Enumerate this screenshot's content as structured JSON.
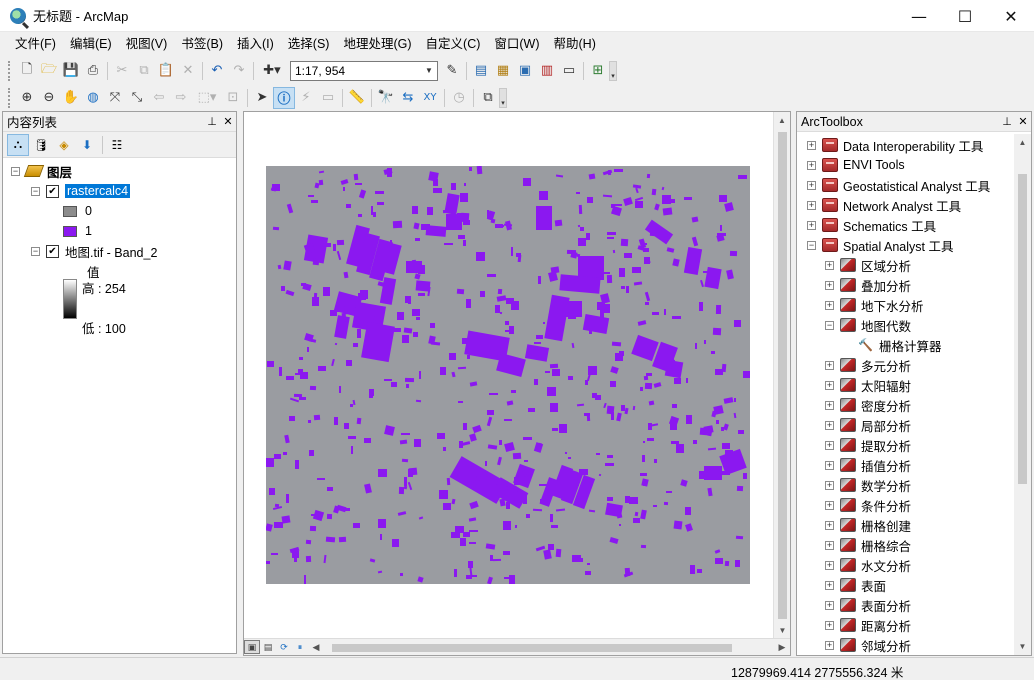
{
  "window": {
    "title": "无标题 - ArcMap",
    "controls": {
      "minimize": "—",
      "maximize": "☐",
      "close": "✕"
    }
  },
  "menu": [
    "文件(F)",
    "编辑(E)",
    "视图(V)",
    "书签(B)",
    "插入(I)",
    "选择(S)",
    "地理处理(G)",
    "自定义(C)",
    "窗口(W)",
    "帮助(H)"
  ],
  "toolbar": {
    "scale": "1:17, 954"
  },
  "toc": {
    "title": "内容列表",
    "pin": "⊥",
    "close": "✕",
    "root_label": "图层",
    "layers": [
      {
        "name": "rastercalc4",
        "checked": true,
        "selected": true,
        "classes": [
          {
            "label": "0",
            "color": "#8c8c8c"
          },
          {
            "label": "1",
            "color": "#8b18f0"
          }
        ]
      },
      {
        "name": "地图.tif - Band_2",
        "checked": true,
        "legend_title": "值",
        "high_label": "高 : 254",
        "low_label": "低 : 100"
      }
    ]
  },
  "map": {
    "background": "#9a9ca1",
    "feature_color": "#8b18f0"
  },
  "toolbox": {
    "title": "ArcToolbox",
    "pin": "⊥",
    "close": "✕",
    "items": [
      {
        "label": "Data Interoperability 工具",
        "level": 0,
        "expander": "+",
        "icon": "box"
      },
      {
        "label": "ENVI Tools",
        "level": 0,
        "expander": "+",
        "icon": "box"
      },
      {
        "label": "Geostatistical Analyst 工具",
        "level": 0,
        "expander": "+",
        "icon": "box"
      },
      {
        "label": "Network Analyst 工具",
        "level": 0,
        "expander": "+",
        "icon": "box"
      },
      {
        "label": "Schematics 工具",
        "level": 0,
        "expander": "+",
        "icon": "box"
      },
      {
        "label": "Spatial Analyst 工具",
        "level": 0,
        "expander": "−",
        "icon": "box"
      },
      {
        "label": "区域分析",
        "level": 1,
        "expander": "+",
        "icon": "set"
      },
      {
        "label": "叠加分析",
        "level": 1,
        "expander": "+",
        "icon": "set"
      },
      {
        "label": "地下水分析",
        "level": 1,
        "expander": "+",
        "icon": "set"
      },
      {
        "label": "地图代数",
        "level": 1,
        "expander": "−",
        "icon": "set"
      },
      {
        "label": "栅格计算器",
        "level": 2,
        "expander": "",
        "icon": "hammer"
      },
      {
        "label": "多元分析",
        "level": 1,
        "expander": "+",
        "icon": "set"
      },
      {
        "label": "太阳辐射",
        "level": 1,
        "expander": "+",
        "icon": "set"
      },
      {
        "label": "密度分析",
        "level": 1,
        "expander": "+",
        "icon": "set"
      },
      {
        "label": "局部分析",
        "level": 1,
        "expander": "+",
        "icon": "set"
      },
      {
        "label": "提取分析",
        "level": 1,
        "expander": "+",
        "icon": "set"
      },
      {
        "label": "插值分析",
        "level": 1,
        "expander": "+",
        "icon": "set"
      },
      {
        "label": "数学分析",
        "level": 1,
        "expander": "+",
        "icon": "set"
      },
      {
        "label": "条件分析",
        "level": 1,
        "expander": "+",
        "icon": "set"
      },
      {
        "label": "栅格创建",
        "level": 1,
        "expander": "+",
        "icon": "set"
      },
      {
        "label": "栅格综合",
        "level": 1,
        "expander": "+",
        "icon": "set"
      },
      {
        "label": "水文分析",
        "level": 1,
        "expander": "+",
        "icon": "set"
      },
      {
        "label": "表面",
        "level": 1,
        "expander": "+",
        "icon": "set"
      },
      {
        "label": "表面分析",
        "level": 1,
        "expander": "+",
        "icon": "set"
      },
      {
        "label": "距离分析",
        "level": 1,
        "expander": "+",
        "icon": "set"
      },
      {
        "label": "邻域分析",
        "level": 1,
        "expander": "+",
        "icon": "set"
      }
    ]
  },
  "status": {
    "coordinates": "12879969.414  2775556.324 米"
  }
}
